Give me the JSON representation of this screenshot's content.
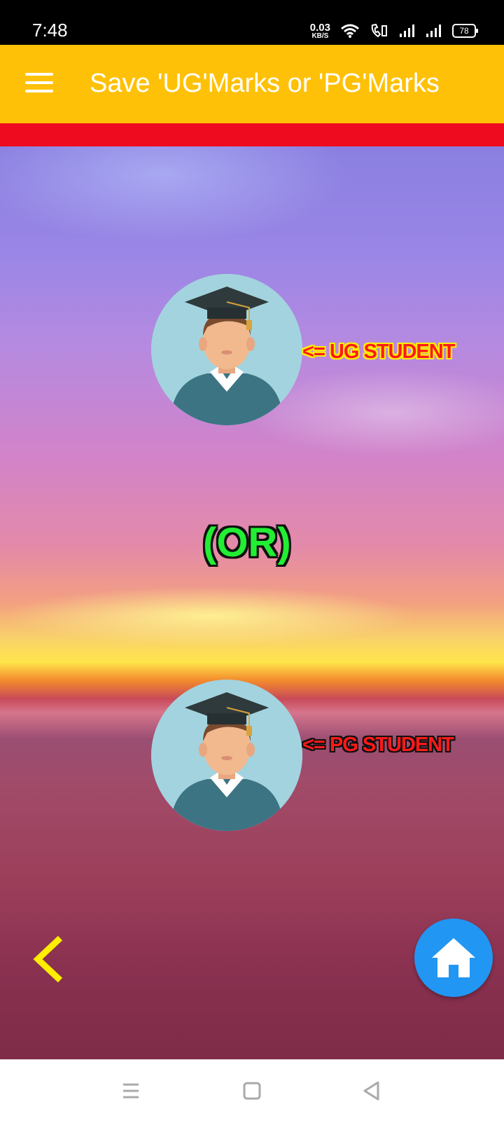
{
  "status_bar": {
    "time": "7:48",
    "net_speed_value": "0.03",
    "net_speed_unit": "KB/S",
    "battery": "78"
  },
  "app_bar": {
    "title": "Save 'UG'Marks or 'PG'Marks",
    "color": "#FFC107"
  },
  "accent_band_color": "#EE0A1F",
  "content": {
    "ug_label": "<= UG STUDENT",
    "or_text": "(OR)",
    "pg_label": "<= PG STUDENT"
  },
  "colors": {
    "home_button": "#2196F3",
    "back_arrow": "#FFEE00"
  },
  "icons": [
    "menu-icon",
    "graduate-avatar-icon",
    "back-chevron-icon",
    "home-icon",
    "nav-menu-icon",
    "nav-home-square-icon",
    "nav-back-triangle-icon"
  ]
}
